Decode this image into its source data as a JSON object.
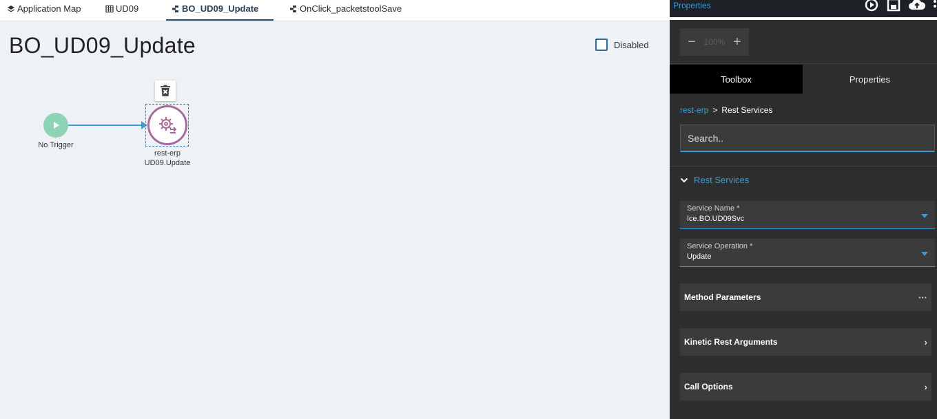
{
  "tabs": [
    {
      "label": "Application Map",
      "icon": "layers-icon"
    },
    {
      "label": "UD09",
      "icon": "grid-icon"
    },
    {
      "label": "BO_UD09_Update",
      "icon": "workflow-icon",
      "active": true
    },
    {
      "label": "OnClick_packetstoolSave",
      "icon": "workflow-icon"
    }
  ],
  "canvas": {
    "title": "BO_UD09_Update",
    "disabled_label": "Disabled",
    "trigger_label": "No Trigger",
    "node_line1": "rest-erp",
    "node_line2": "UD09.Update"
  },
  "panel": {
    "top_title": "Properties",
    "zoom_minus": "−",
    "zoom_value": "100%",
    "zoom_plus": "+",
    "tab_toolbox": "Toolbox",
    "tab_properties": "Properties",
    "breadcrumb_link": "rest-erp",
    "breadcrumb_sep": ">",
    "breadcrumb_current": "Rest Services",
    "search_placeholder": "Search..",
    "section_title": "Rest Services",
    "service_name_label": "Service Name *",
    "service_name_value": "Ice.BO.UD09Svc",
    "service_op_label": "Service Operation *",
    "service_op_value": "Update",
    "method_params_label": "Method Parameters",
    "method_params_more": "···",
    "kinetic_args_label": "Kinetic Rest Arguments",
    "call_options_label": "Call Options",
    "chevron": "›"
  },
  "colors": {
    "accent": "#3a9ad9",
    "node_border": "#a66c99",
    "trigger": "#8fd3b5",
    "connector": "#3b9fd6"
  }
}
